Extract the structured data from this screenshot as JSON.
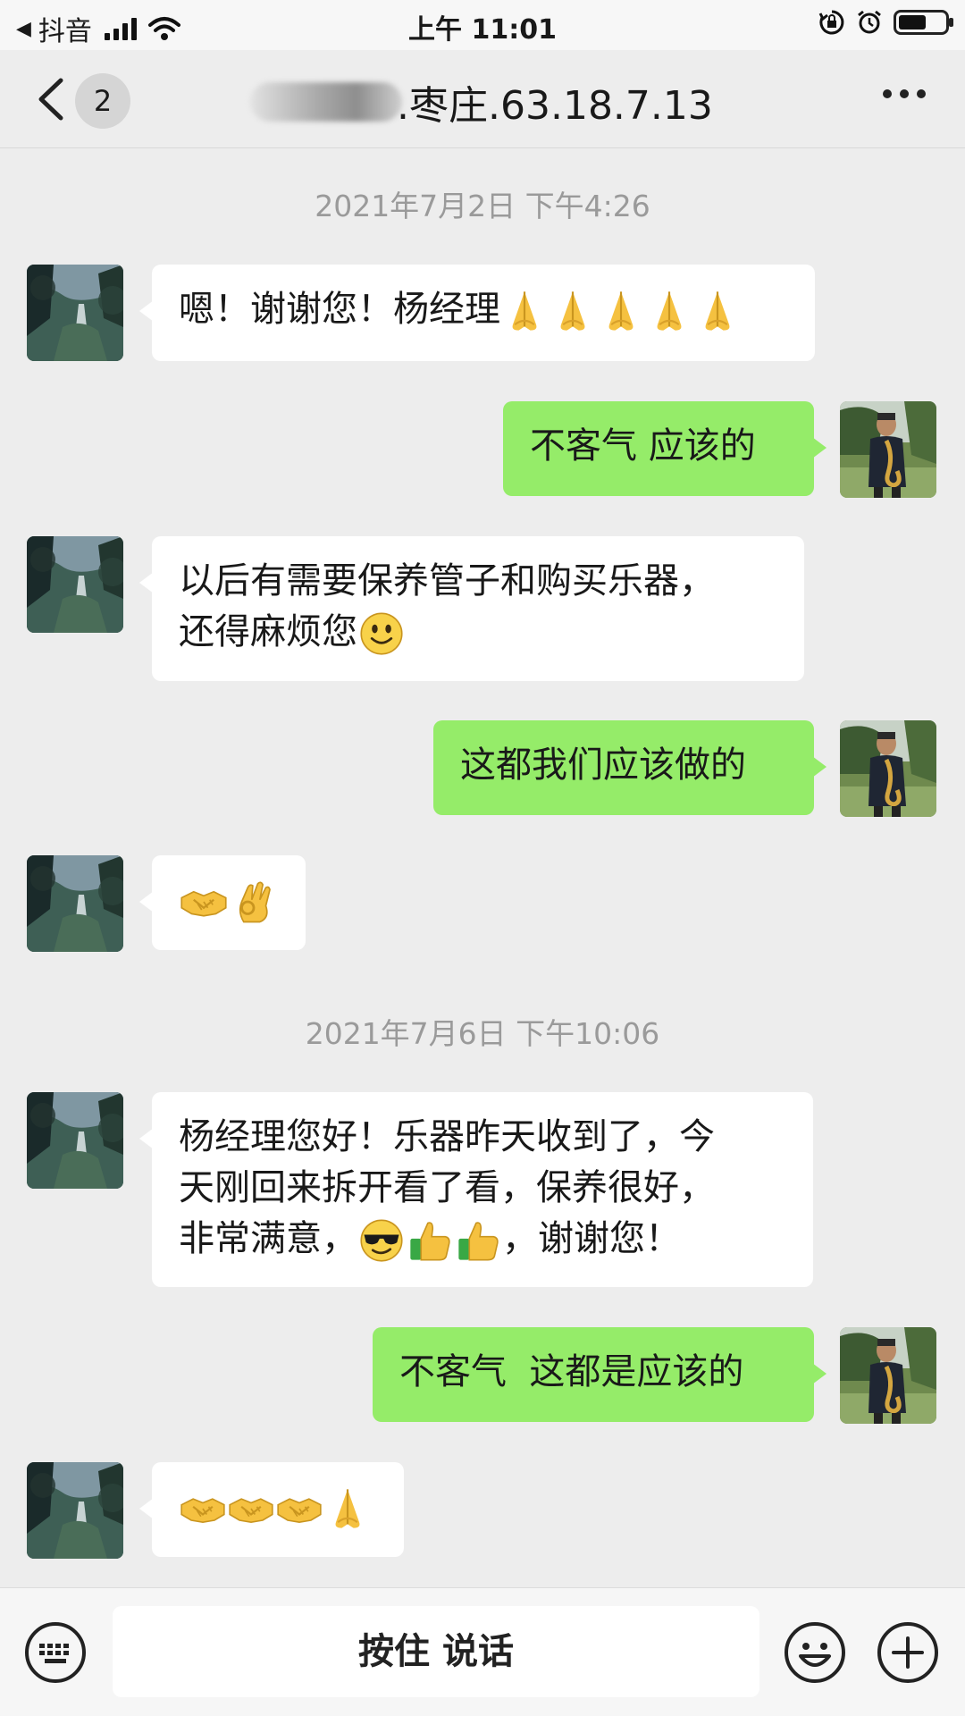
{
  "status_bar": {
    "back_app": "抖音",
    "time": "上午 11:01",
    "battery_fraction": 0.6
  },
  "nav": {
    "unread_count": "2",
    "title": ".枣庄.63.18.7.13",
    "more_icon": "more-dots-icon"
  },
  "messages": [
    {
      "type": "timestamp",
      "text": "2021年7月2日 下午4:26"
    },
    {
      "type": "received",
      "text": "嗯！谢谢您！杨经理",
      "emoji": [
        "pray",
        "pray",
        "pray",
        "pray",
        "pray"
      ]
    },
    {
      "type": "sent",
      "text": "不客气 应该的"
    },
    {
      "type": "received",
      "lines": [
        "以后有需要保养管子和购买乐器，",
        "还得麻烦您"
      ],
      "emoji": [
        "smile"
      ]
    },
    {
      "type": "sent",
      "text": "这都我们应该做的"
    },
    {
      "type": "received",
      "emoji": [
        "handshake",
        "ok-hand"
      ]
    },
    {
      "type": "timestamp",
      "text": "2021年7月6日 下午10:06"
    },
    {
      "type": "received",
      "lines": [
        "杨经理您好！乐器昨天收到了，今",
        "天刚回来拆开看了看，保养很好，",
        "非常满意，",
        "，谢谢您！"
      ],
      "emoji": [
        "sunglasses",
        "thumbs-up",
        "thumbs-up"
      ]
    },
    {
      "type": "sent",
      "text": "不客气  这都是应该的"
    },
    {
      "type": "received",
      "emoji": [
        "handshake",
        "handshake",
        "handshake",
        "pray"
      ]
    }
  ],
  "input_bar": {
    "hold_to_talk": "按住 说话",
    "left_icon": "keyboard-icon",
    "right_icons": [
      "emoji-icon",
      "plus-icon"
    ]
  },
  "colors": {
    "background": "#ededed",
    "sent_bubble": "#95ec69",
    "received_bubble": "#ffffff",
    "timestamp_text": "#9a9a9a"
  }
}
